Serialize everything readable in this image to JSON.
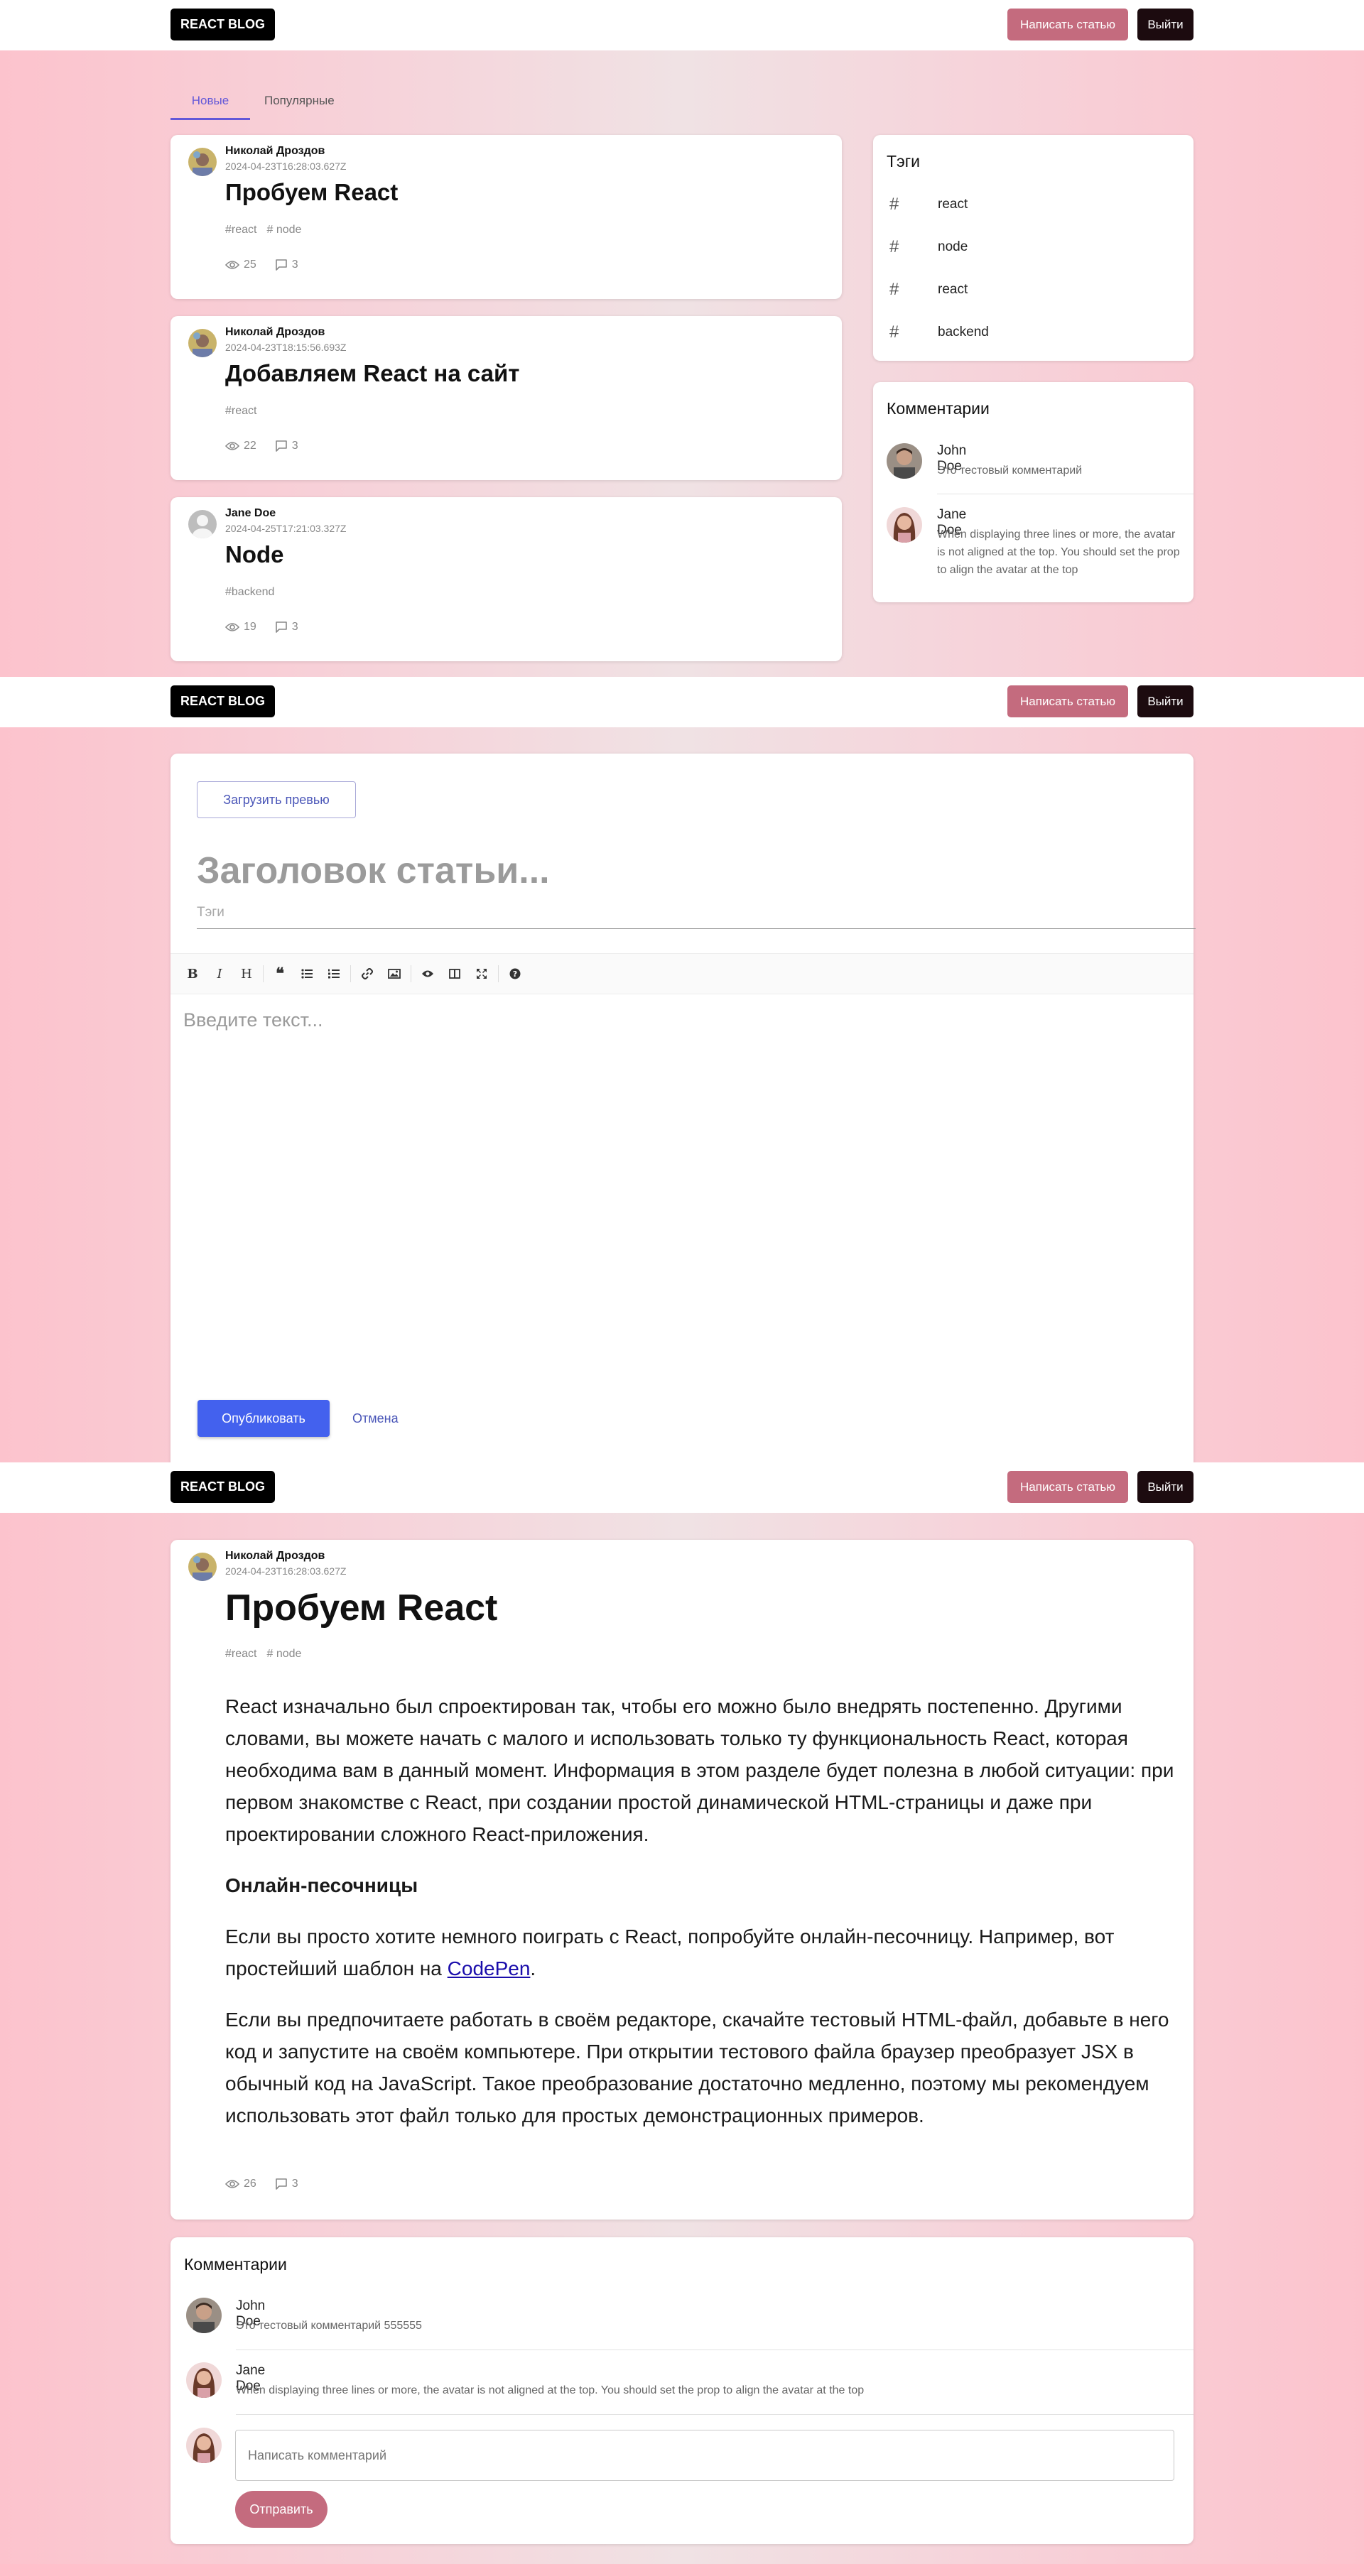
{
  "header": {
    "logo": "REACT BLOG",
    "write_button": "Написать статью",
    "logout_button": "Выйти"
  },
  "home": {
    "tabs": [
      {
        "label": "Новые"
      },
      {
        "label": "Популярные"
      }
    ],
    "posts": [
      {
        "author": "Николай Дроздов",
        "date": "2024-04-23T16:28:03.627Z",
        "title": "Пробуем React",
        "tags": [
          "#react",
          "# node"
        ],
        "views": "25",
        "comments": "3"
      },
      {
        "author": "Николай Дроздов",
        "date": "2024-04-23T18:15:56.693Z",
        "title": "Добавляем React на сайт",
        "tags": [
          "#react"
        ],
        "views": "22",
        "comments": "3"
      },
      {
        "author": "Jane Doe",
        "date": "2024-04-25T17:21:03.327Z",
        "title": "Node",
        "tags": [
          "#backend"
        ],
        "views": "19",
        "comments": "3"
      }
    ],
    "tags_block": {
      "title": "Тэги",
      "items": [
        "react",
        "node",
        "react",
        "backend"
      ],
      "hash": "#"
    },
    "comments_block": {
      "title": "Комментарии",
      "items": [
        {
          "name": "John Doe",
          "text": "Это тестовый комментарий"
        },
        {
          "name": "Jane Doe",
          "text": "When displaying three lines or more, the avatar is not aligned at the top. You should set the prop to align the avatar at the top"
        }
      ]
    }
  },
  "editor": {
    "upload_button": "Загрузить превью",
    "title_placeholder": "Заголовок статьи...",
    "tags_placeholder": "Тэги",
    "toolbar": [
      "bold",
      "italic",
      "heading",
      "quote",
      "unordered-list",
      "ordered-list",
      "link",
      "image",
      "preview",
      "side-by-side",
      "fullscreen",
      "guide"
    ],
    "text_placeholder": "Введите текст...",
    "publish_button": "Опубликовать",
    "cancel_button": "Отмена"
  },
  "article": {
    "author": "Николай Дроздов",
    "date": "2024-04-23T16:28:03.627Z",
    "title": "Пробуем React",
    "tags": [
      "#react",
      "# node"
    ],
    "p1": "React изначально был спроектирован так, чтобы его можно было внедрять постепенно. Другими словами, вы можете начать с малого и использовать только ту функциональность React, которая необходима вам в данный момент. Информация в этом разделе будет полезна в любой ситуации: при первом знакомстве с React, при создании простой динамической HTML-страницы и даже при проектировании сложного React-приложения.",
    "subheading": "Онлайн-песочницы",
    "p2_before": "Если вы просто хотите немного поиграть с React, попробуйте онлайн-песочницу. Например, вот простейший шаблон на ",
    "p2_link": "CodePen",
    "p2_after": ".",
    "p3": "Если вы предпочитаете работать в своём редакторе, скачайте тестовый HTML-файл, добавьте в него код и запустите на своём компьютере. При открытии тестового файла браузер преобразует JSX в обычный код на JavaScript. Такое преобразование достаточно медленно, поэтому мы рекомендуем использовать этот файл только для простых демонстрационных примеров.",
    "views": "26",
    "comments": "3"
  },
  "article_comments": {
    "title": "Комментарии",
    "items": [
      {
        "name": "John Doe",
        "text": "Это тестовый комментарий 555555"
      },
      {
        "name": "Jane Doe",
        "text": "When displaying three lines or more, the avatar is not aligned at the top. You should set the prop to align the avatar at the top"
      }
    ],
    "input_placeholder": "Написать комментарий",
    "send_button": "Отправить"
  }
}
